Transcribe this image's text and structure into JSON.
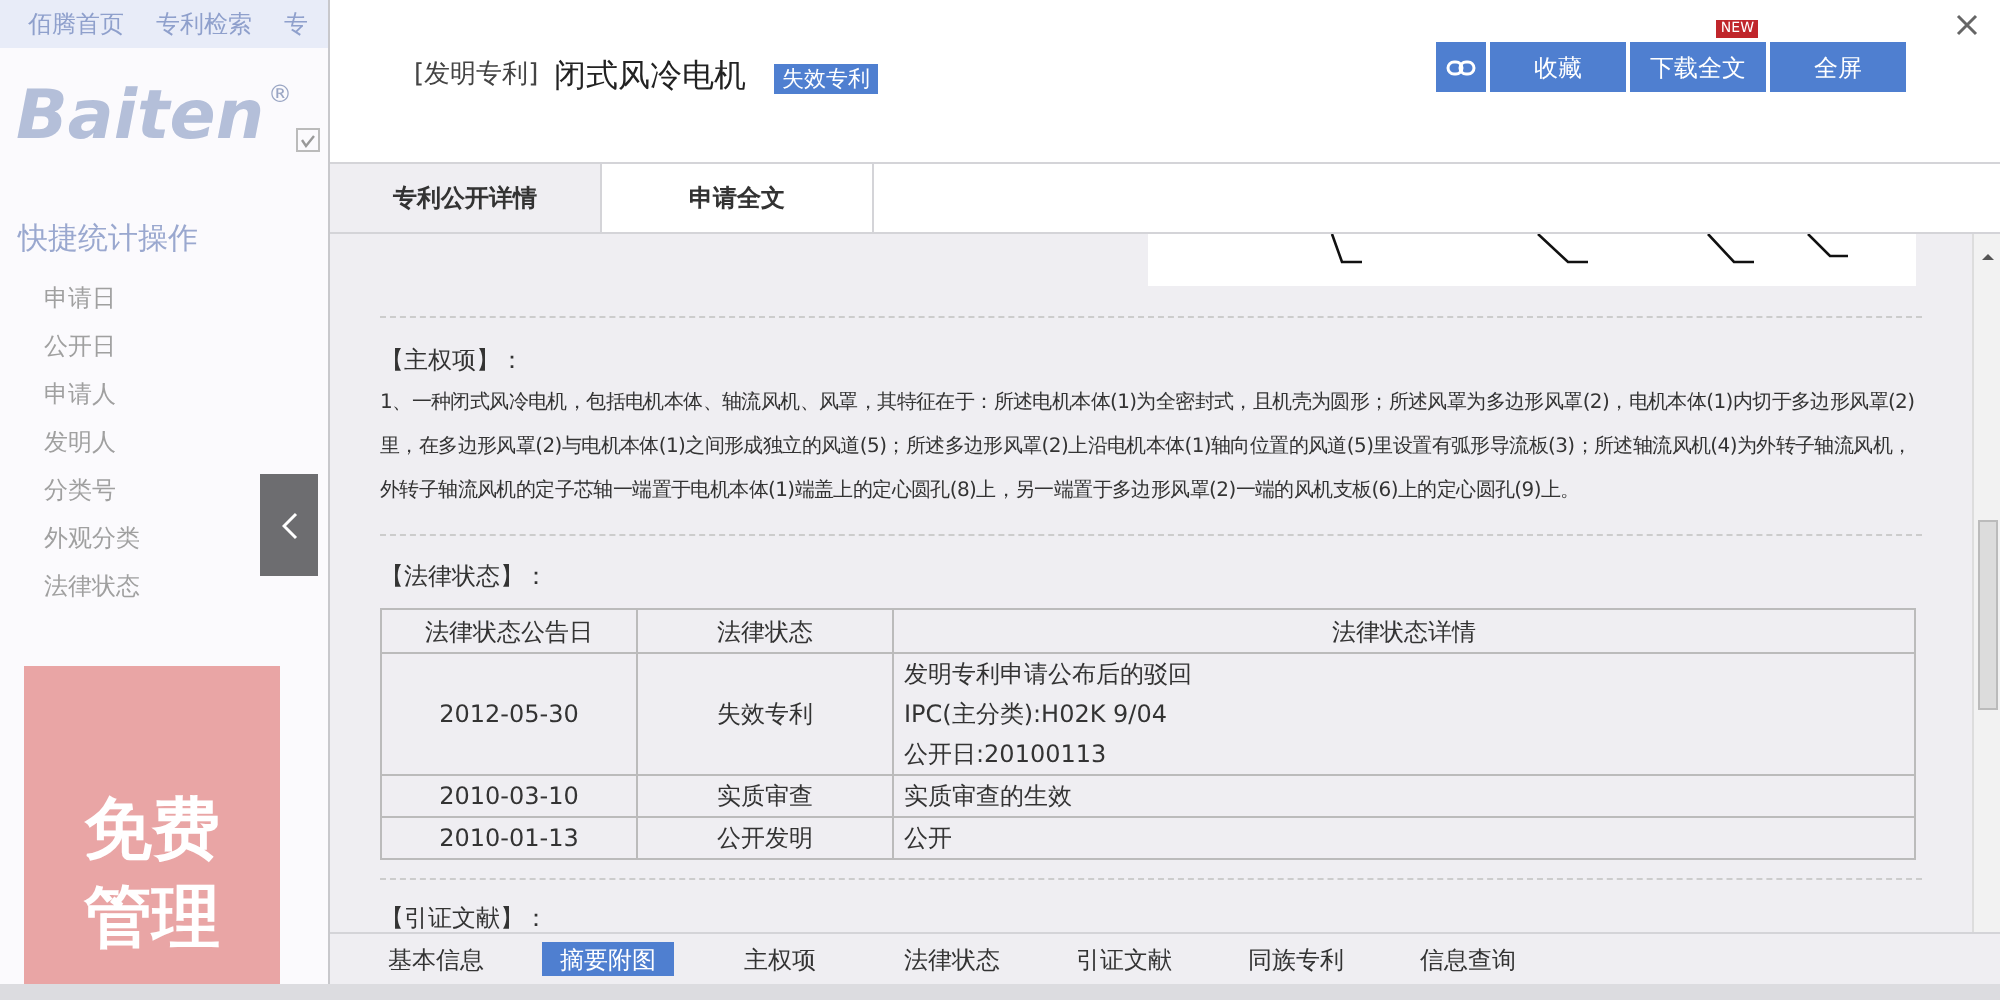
{
  "background_page": {
    "nav_links": [
      "佰腾首页",
      "专利检索",
      "专"
    ],
    "logo": "Baiten",
    "logo_mark": "®",
    "checkbox_checked": true,
    "sidebar": {
      "title": "快捷统计操作",
      "items": [
        "申请日",
        "公开日",
        "申请人",
        "发明人",
        "分类号",
        "外观分类",
        "法律状态"
      ]
    },
    "banner_lines": [
      "免费",
      "管理"
    ]
  },
  "modal": {
    "type_label": "[发明专利]",
    "title": "闭式风冷电机",
    "status_badge": "失效专利",
    "buttons": [
      {
        "kind": "icon"
      },
      {
        "kind": "text",
        "label": "收藏"
      },
      {
        "kind": "text",
        "label": "下载全文",
        "badge": "NEW"
      },
      {
        "kind": "text",
        "label": "全屏"
      }
    ],
    "tabs": [
      {
        "label": "专利公开详情",
        "selected": true
      },
      {
        "label": "申请全文",
        "selected": false
      }
    ],
    "claims": {
      "heading": "【主权项】：",
      "text": "1、一种闭式风冷电机，包括电机本体、轴流风机、风罩，其特征在于：所述电机本体(1)为全密封式，且机壳为圆形；所述风罩为多边形风罩(2)，电机本体(1)内切于多边形风罩(2)里，在多边形风罩(2)与电机本体(1)之间形成独立的风道(5)；所述多边形风罩(2)上沿电机本体(1)轴向位置的风道(5)里设置有弧形导流板(3)；所述轴流风机(4)为外转子轴流风机，外转子轴流风机的定子芯轴一端置于电机本体(1)端盖上的定心圆孔(8)上，另一端置于多边形风罩(2)一端的风机支板(6)上的定心圆孔(9)上。"
    },
    "legal_status": {
      "heading": "【法律状态】：",
      "columns": [
        "法律状态公告日",
        "法律状态",
        "法律状态详情"
      ],
      "rows": [
        {
          "date": "2012-05-30",
          "status": "失效专利",
          "details": [
            "发明专利申请公布后的驳回",
            "IPC(主分类):H02K 9/04",
            "公开日:20100113"
          ]
        },
        {
          "date": "2010-03-10",
          "status": "实质审查",
          "details": [
            "实质审查的生效"
          ]
        },
        {
          "date": "2010-01-13",
          "status": "公开发明",
          "details": [
            "公开"
          ]
        }
      ]
    },
    "citations": {
      "heading": "【引证文献】："
    },
    "bottom_nav": [
      {
        "label": "基本信息",
        "selected": false
      },
      {
        "label": "摘要附图",
        "selected": true
      },
      {
        "label": "主权项",
        "selected": false
      },
      {
        "label": "法律状态",
        "selected": false
      },
      {
        "label": "引证文献",
        "selected": false
      },
      {
        "label": "同族专利",
        "selected": false
      },
      {
        "label": "信息查询",
        "selected": false
      }
    ]
  }
}
